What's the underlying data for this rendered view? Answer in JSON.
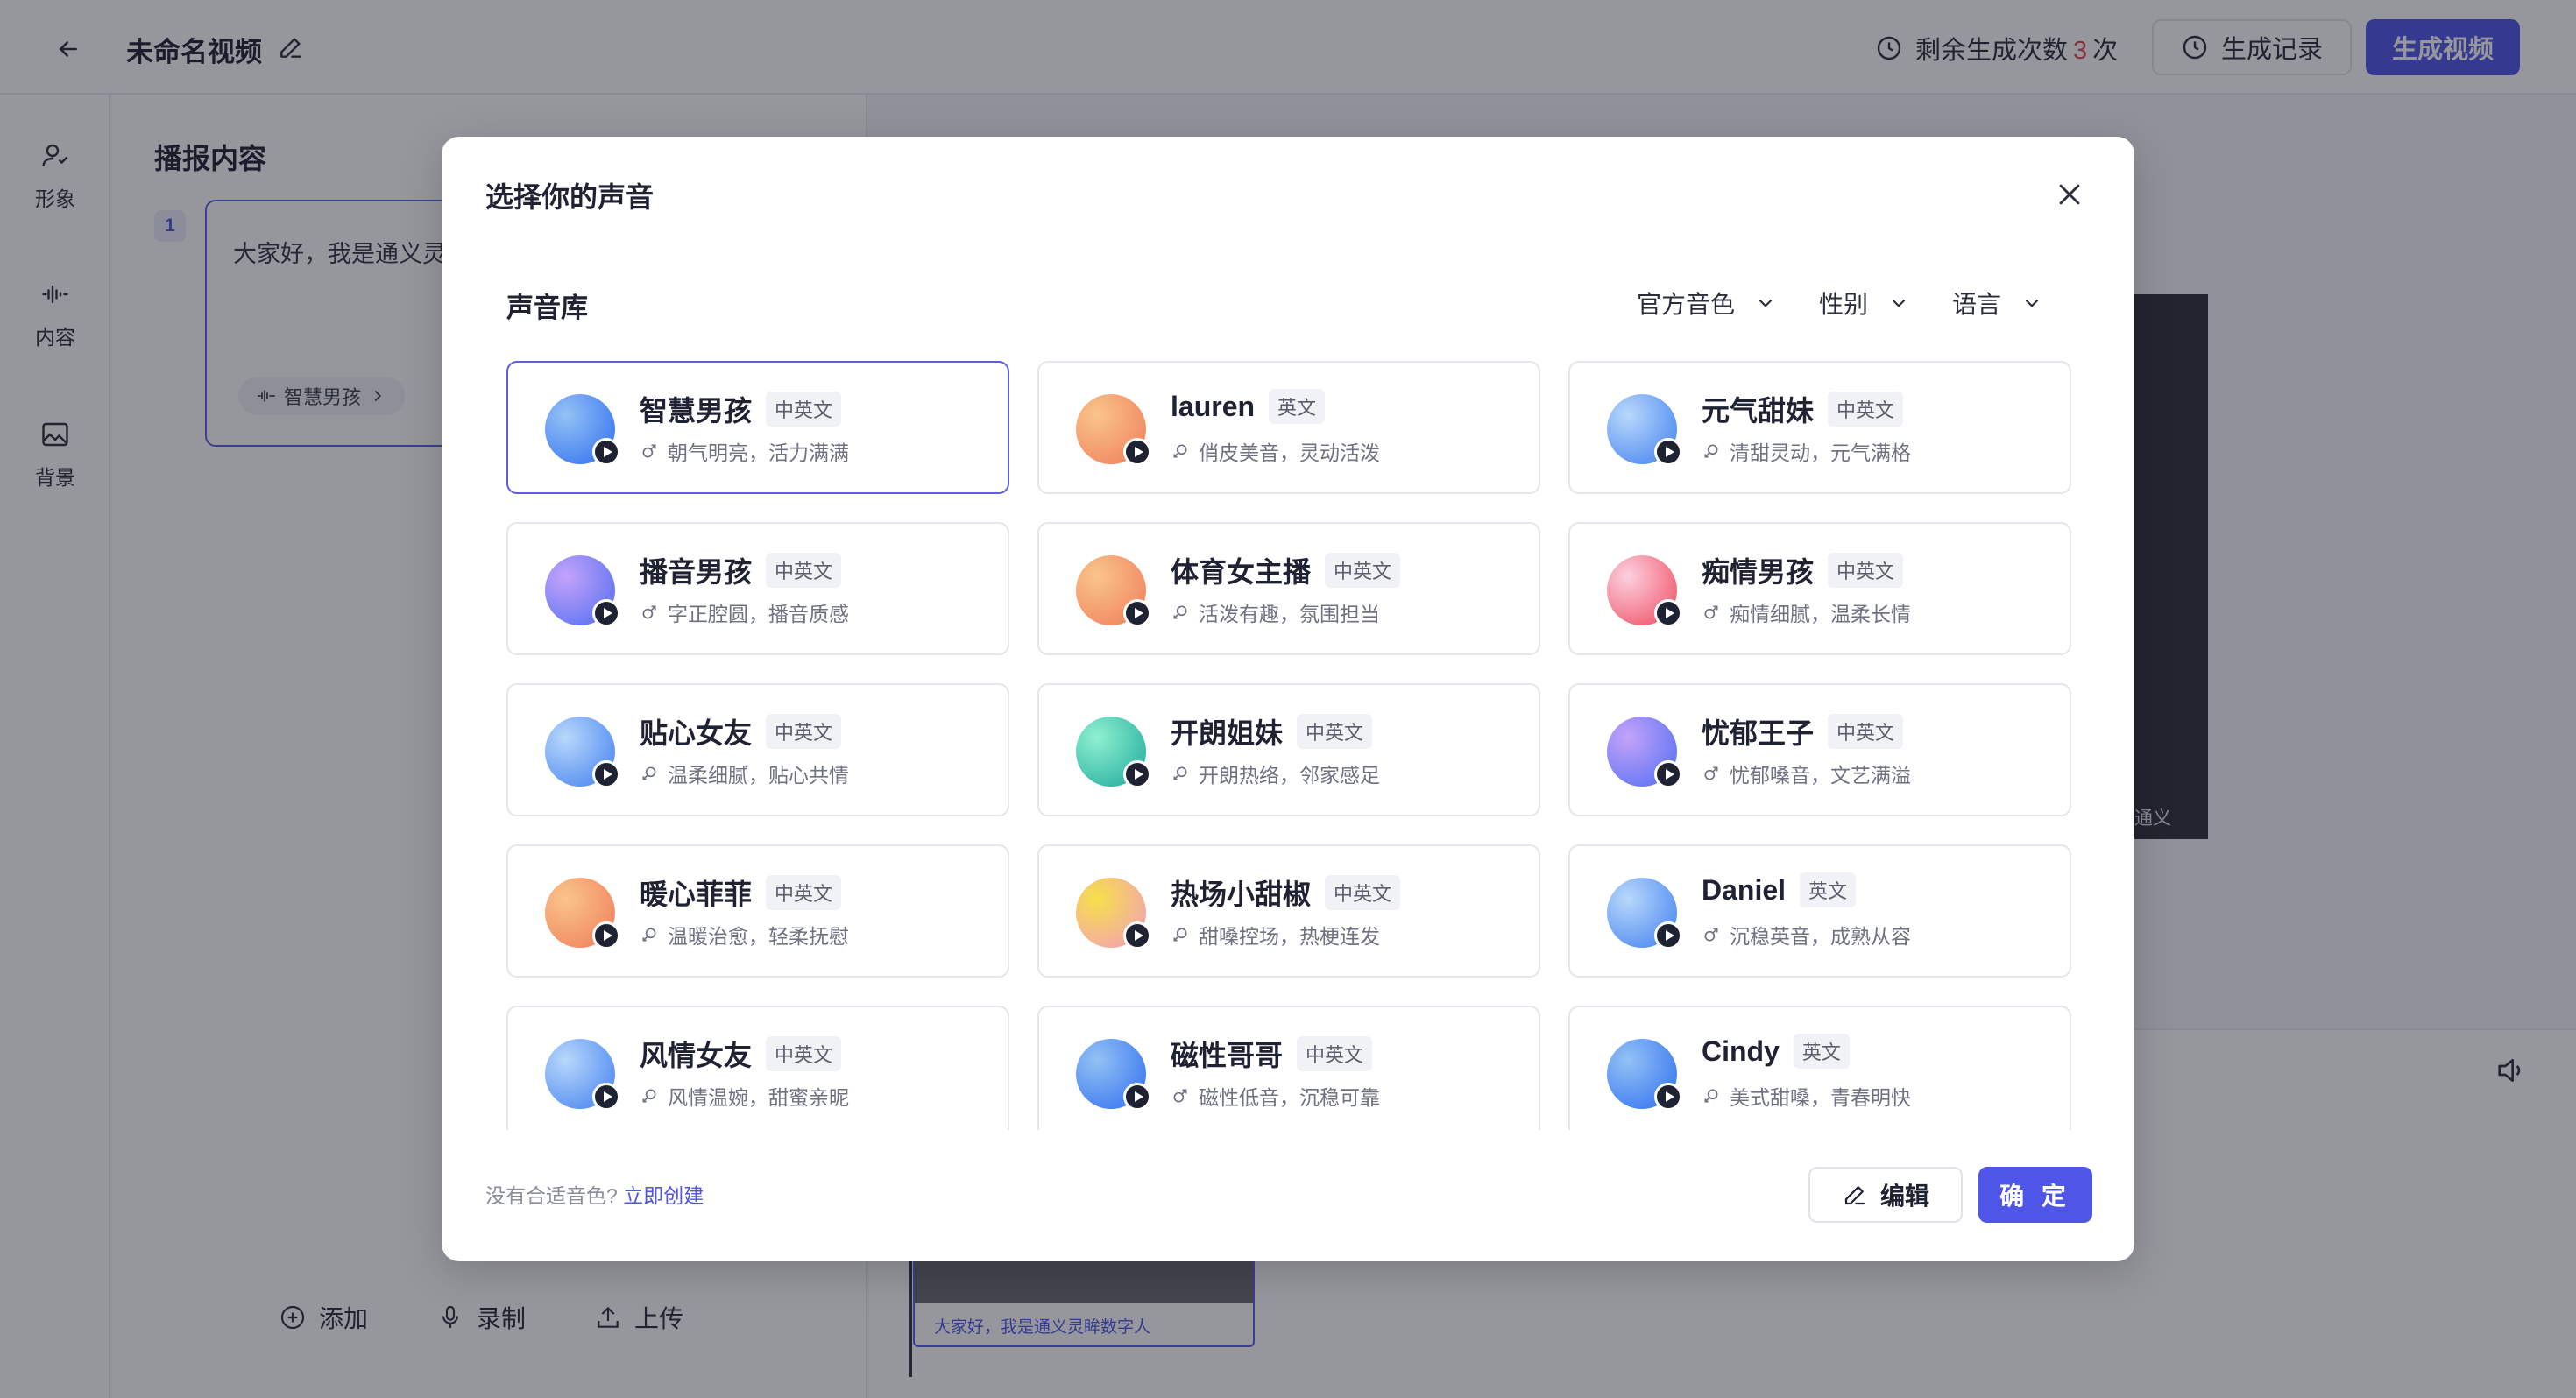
{
  "header": {
    "title": "未命名视频",
    "remain_label": "剩余生成次数",
    "remain_count": "3",
    "remain_unit": "次",
    "history_label": "生成记录",
    "generate_label": "生成视频"
  },
  "sidebar": {
    "items": [
      {
        "label": "形象",
        "icon": "person-icon"
      },
      {
        "label": "内容",
        "icon": "waveform-icon"
      },
      {
        "label": "背景",
        "icon": "image-icon"
      }
    ]
  },
  "content": {
    "title": "播报内容",
    "para_index": "1",
    "para_text": "大家好，我是通义灵",
    "voice_chip": "智慧男孩",
    "actions": {
      "add": "添加",
      "record": "录制",
      "upload": "上传"
    }
  },
  "preview": {
    "watermark": "通义"
  },
  "timeline": {
    "clip_caption": "大家好，我是通义灵眸数字人"
  },
  "modal": {
    "title": "选择你的声音",
    "library_title": "声音库",
    "filters": [
      "官方音色",
      "性别",
      "语言"
    ],
    "voices": [
      {
        "name": "智慧男孩",
        "lang": "中英文",
        "gender": "male",
        "desc": "朝气明亮，活力满满",
        "gradient": [
          "#93c2f5",
          "#2d6cf0"
        ],
        "selected": true
      },
      {
        "name": "lauren",
        "lang": "英文",
        "gender": "female",
        "desc": "俏皮美音，灵动活泼",
        "gradient": [
          "#f9c58a",
          "#f07a5a"
        ],
        "selected": false
      },
      {
        "name": "元气甜妹",
        "lang": "中英文",
        "gender": "female",
        "desc": "清甜灵动，元气满格",
        "gradient": [
          "#b8d8fb",
          "#3f7ef0"
        ],
        "selected": false
      },
      {
        "name": "播音男孩",
        "lang": "中英文",
        "gender": "male",
        "desc": "字正腔圆，播音质感",
        "gradient": [
          "#c4a3fa",
          "#4d6cf2"
        ],
        "selected": false
      },
      {
        "name": "体育女主播",
        "lang": "中英文",
        "gender": "female",
        "desc": "活泼有趣，氛围担当",
        "gradient": [
          "#f9c58a",
          "#f07a5a"
        ],
        "selected": false
      },
      {
        "name": "痴情男孩",
        "lang": "中英文",
        "gender": "male",
        "desc": "痴情细腻，温柔长情",
        "gradient": [
          "#fbd1df",
          "#f0465c"
        ],
        "selected": false
      },
      {
        "name": "贴心女友",
        "lang": "中英文",
        "gender": "female",
        "desc": "温柔细腻，贴心共情",
        "gradient": [
          "#b8d8fb",
          "#3f7ef0"
        ],
        "selected": false
      },
      {
        "name": "开朗姐妹",
        "lang": "中英文",
        "gender": "female",
        "desc": "开朗热络，邻家感足",
        "gradient": [
          "#8ff0d0",
          "#1aa89a"
        ],
        "selected": false
      },
      {
        "name": "忧郁王子",
        "lang": "中英文",
        "gender": "male",
        "desc": "忧郁嗓音，文艺满溢",
        "gradient": [
          "#c4a3fa",
          "#4d6cf2"
        ],
        "selected": false
      },
      {
        "name": "暖心菲菲",
        "lang": "中英文",
        "gender": "female",
        "desc": "温暖治愈，轻柔抚慰",
        "gradient": [
          "#f9c58a",
          "#f07a5a"
        ],
        "selected": false
      },
      {
        "name": "热场小甜椒",
        "lang": "中英文",
        "gender": "female",
        "desc": "甜嗓控场，热梗连发",
        "gradient": [
          "#f6e04a",
          "#f29ac0"
        ],
        "selected": false
      },
      {
        "name": "Daniel",
        "lang": "英文",
        "gender": "male",
        "desc": "沉稳英音，成熟从容",
        "gradient": [
          "#b8d8fb",
          "#3f7ef0"
        ],
        "selected": false
      },
      {
        "name": "风情女友",
        "lang": "中英文",
        "gender": "female",
        "desc": "风情温婉，甜蜜亲昵",
        "gradient": [
          "#b8d8fb",
          "#3f7ef0"
        ],
        "selected": false
      },
      {
        "name": "磁性哥哥",
        "lang": "中英文",
        "gender": "male",
        "desc": "磁性低音，沉稳可靠",
        "gradient": [
          "#93c2f5",
          "#2d6cf0"
        ],
        "selected": false
      },
      {
        "name": "Cindy",
        "lang": "英文",
        "gender": "female",
        "desc": "美式甜嗓，青春明快",
        "gradient": [
          "#93c2f5",
          "#2d6cf0"
        ],
        "selected": false
      }
    ],
    "footer": {
      "note": "没有合适音色?",
      "create_link": "立即创建",
      "edit_label": "编辑",
      "confirm_label": "确 定"
    }
  }
}
